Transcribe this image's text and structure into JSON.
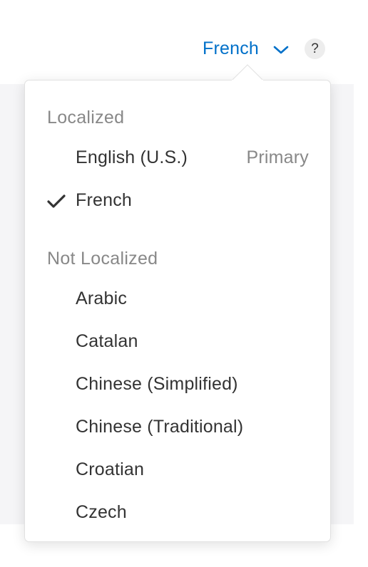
{
  "header": {
    "selected_language": "French",
    "help_label": "?"
  },
  "menu": {
    "localized_header": "Localized",
    "localized_items": [
      {
        "label": "English (U.S.)",
        "badge": "Primary",
        "checked": false
      },
      {
        "label": "French",
        "badge": "",
        "checked": true
      }
    ],
    "not_localized_header": "Not Localized",
    "not_localized_items": [
      {
        "label": "Arabic"
      },
      {
        "label": "Catalan"
      },
      {
        "label": "Chinese (Simplified)"
      },
      {
        "label": "Chinese (Traditional)"
      },
      {
        "label": "Croatian"
      },
      {
        "label": "Czech"
      }
    ]
  },
  "colors": {
    "accent": "#0070c9",
    "text": "#333333",
    "muted": "#888888",
    "background_band": "#f5f5f7"
  },
  "icons": {
    "chevron": "chevron-down-icon",
    "check": "checkmark-icon",
    "help": "question-mark-icon"
  }
}
